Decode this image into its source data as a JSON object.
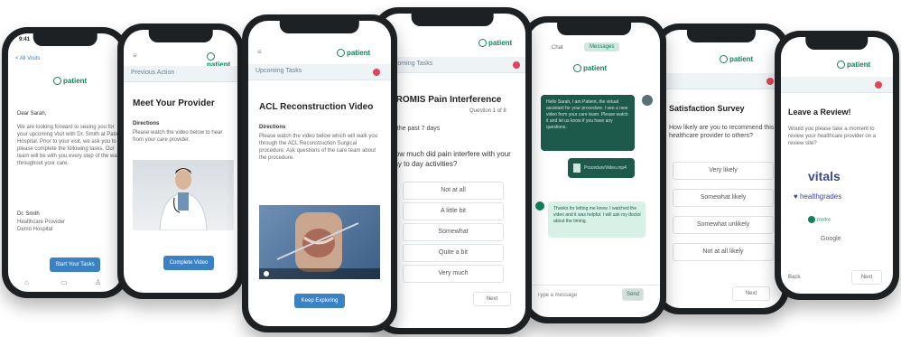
{
  "brand": {
    "name": "patient",
    "color": "#13815d",
    "accent": "#3b82c4"
  },
  "phone1": {
    "time": "9:41",
    "back_label": "< All Visits",
    "greeting": "Dear Sarah,",
    "body": "We are looking forward to seeing you for your upcoming Visit with Dr. Smith at Patient Hospital. Prior to your visit, we ask you to please complete the following tasks. Our team will be with you every step of the way throughout your care.",
    "signature": "Dr. Smith",
    "signature_org1": "Healthcare Provider",
    "signature_org2": "Demo Hospital",
    "button": "Start Your Tasks",
    "tab_icons": [
      "home-icon",
      "messages-icon",
      "profile-icon"
    ]
  },
  "phone2": {
    "bar": "Previous Action",
    "title": "Meet Your Provider",
    "directions_label": "Directions",
    "directions": "Please watch the video below to hear from your care provider.",
    "button": "Complete Video"
  },
  "phone3": {
    "bar": "Upcoming Tasks",
    "title": "ACL Reconstruction Video",
    "directions_label": "Directions",
    "directions": "Please watch the video below which will walk you through the ACL Reconstruction Surgical procedure. Ask questions of the care team about the procedure.",
    "button": "Keep Exploring"
  },
  "phone4": {
    "bar": "Upcoming Tasks",
    "title": "PROMIS Pain Interference",
    "subtitle": "Question 1 of 8",
    "period": "In the past 7 days",
    "question": "How much did pain interfere with your day to day activities?",
    "options": [
      "Not at all",
      "A little bit",
      "Somewhat",
      "Quite a bit",
      "Very much"
    ],
    "next": "Next"
  },
  "phone5": {
    "tabs": [
      "Chat",
      "Messages"
    ],
    "incoming": "Hello Sarah, I am Patient, the virtual assistant for your procedure. I see a new video from your care team. Please watch it and let us know if you have any questions.",
    "attachment": "ProcedureVideo.mp4",
    "outgoing": "Thanks for letting me know. I watched the video and it was helpful. I will ask my doctor about the timing.",
    "input_placeholder": "Type a message",
    "send": "Send"
  },
  "phone6": {
    "title": "Satisfaction Survey",
    "question": "How likely are you to recommend this healthcare provider to others?",
    "options": [
      "Very likely",
      "Somewhat likely",
      "Somewhat unlikely",
      "Not at all likely"
    ],
    "next": "Next"
  },
  "phone7": {
    "title": "Leave a Review!",
    "prompt": "Would you please take a moment to review your healthcare provider on a review site?",
    "sites": [
      "vitals",
      "healthgrades",
      "zocdoc",
      "Google"
    ],
    "next": "Next",
    "back": "Back"
  }
}
